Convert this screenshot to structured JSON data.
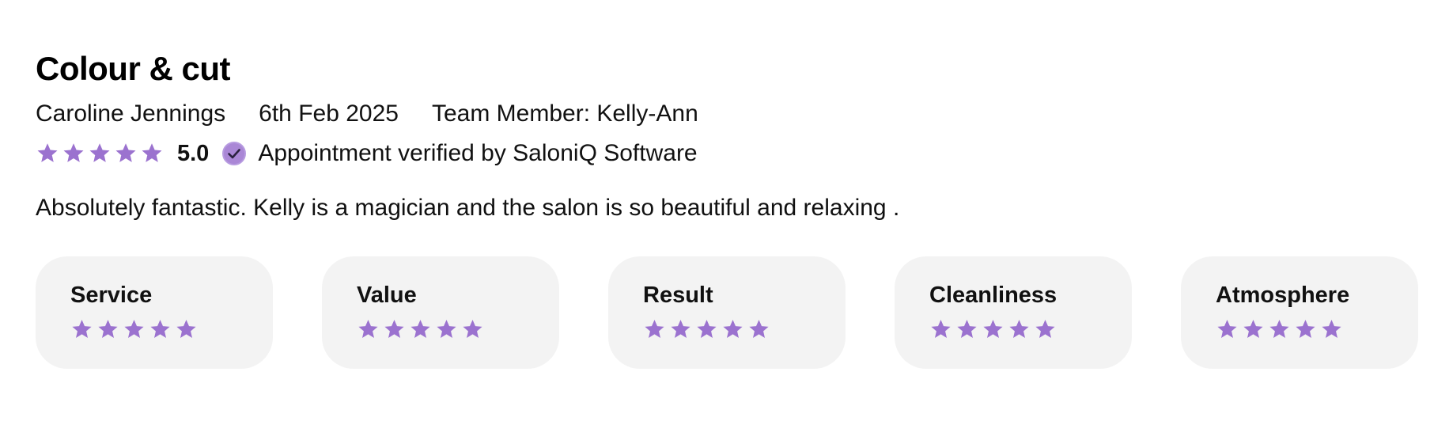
{
  "review": {
    "title": "Colour & cut",
    "reviewer": "Caroline Jennings",
    "date": "6th Feb 2025",
    "team_member": "Team Member: Kelly-Ann",
    "rating": "5.0",
    "rating_value": 5,
    "verified_text": "Appointment verified by SaloniQ Software",
    "body": "Absolutely fantastic. Kelly is a magician and the salon is so beautiful and relaxing ."
  },
  "categories": [
    {
      "label": "Service",
      "stars": 5
    },
    {
      "label": "Value",
      "stars": 5
    },
    {
      "label": "Result",
      "stars": 5
    },
    {
      "label": "Cleanliness",
      "stars": 5
    },
    {
      "label": "Atmosphere",
      "stars": 5
    }
  ],
  "icons": {
    "star": "star-icon",
    "verified": "verified-check-icon"
  },
  "colors": {
    "star": "#9B72CF",
    "verified_badge": "#9B72CF",
    "card_background": "#F3F3F3",
    "text": "#111111"
  }
}
